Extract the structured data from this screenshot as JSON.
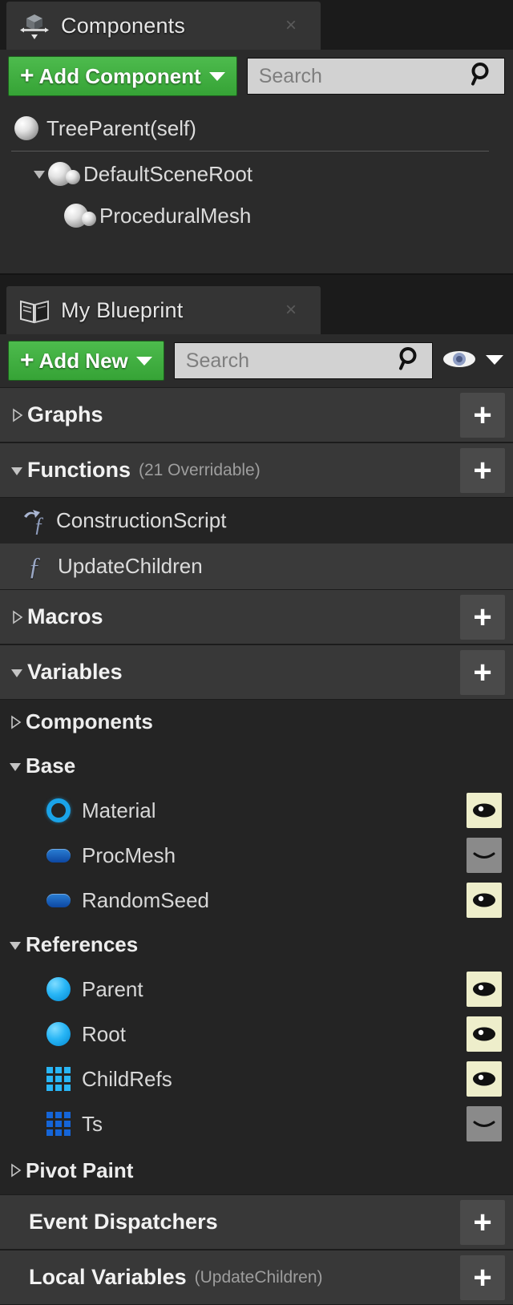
{
  "components_panel": {
    "tab": {
      "label": "Components",
      "icon": "components-gizmo-icon",
      "close": "×"
    },
    "toolbar": {
      "add_label": "Add Component",
      "add_plus": "+",
      "search_placeholder": "Search"
    },
    "tree": [
      {
        "label": "TreeParent(self)",
        "icon": "sphere-icon",
        "depth": 0,
        "expander": "none"
      },
      {
        "label": "DefaultSceneRoot",
        "icon": "scene-component-icon",
        "depth": 1,
        "expander": "expanded"
      },
      {
        "label": "ProceduralMesh",
        "icon": "scene-component-icon",
        "depth": 2,
        "expander": "none"
      }
    ]
  },
  "my_blueprint_panel": {
    "tab": {
      "label": "My Blueprint",
      "icon": "book-icon",
      "close": "×"
    },
    "toolbar": {
      "add_label": "Add New",
      "add_plus": "+",
      "search_placeholder": "Search",
      "eye_icon": "eye-icon",
      "eye_caret": "chevron-down-icon"
    },
    "sections": [
      {
        "title": "Graphs",
        "sub": "",
        "expander": "collapsed",
        "add": "+"
      },
      {
        "title": "Functions",
        "sub": "(21 Overridable)",
        "expander": "expanded",
        "add": "+"
      },
      {
        "title": "Macros",
        "sub": "",
        "expander": "collapsed",
        "add": "+"
      },
      {
        "title": "Variables",
        "sub": "",
        "expander": "expanded",
        "add": "+"
      },
      {
        "title": "Event Dispatchers",
        "sub": "",
        "expander": "none",
        "add": "+"
      },
      {
        "title": "Local Variables",
        "sub": "(UpdateChildren)",
        "expander": "none",
        "add": "+"
      }
    ],
    "functions": [
      {
        "label": "ConstructionScript",
        "glyph": "ƒ",
        "icon": "construction-script-icon",
        "selected": false
      },
      {
        "label": "UpdateChildren",
        "glyph": "ƒ",
        "icon": "function-icon",
        "selected": true
      }
    ],
    "variable_categories": [
      {
        "name": "Components",
        "expander": "collapsed",
        "variables": []
      },
      {
        "name": "Base",
        "expander": "expanded",
        "variables": [
          {
            "name": "Material",
            "pip": "ring",
            "pip_kind": "object-ref-icon",
            "visible": true
          },
          {
            "name": "ProcMesh",
            "pip": "pill",
            "pip_kind": "struct-icon",
            "visible": false
          },
          {
            "name": "RandomSeed",
            "pip": "pill",
            "pip_kind": "struct-icon",
            "visible": true
          }
        ]
      },
      {
        "name": "References",
        "expander": "expanded",
        "variables": [
          {
            "name": "Parent",
            "pip": "ball",
            "pip_kind": "object-icon",
            "visible": true
          },
          {
            "name": "Root",
            "pip": "ball",
            "pip_kind": "object-icon",
            "visible": true
          },
          {
            "name": "ChildRefs",
            "pip": "grid",
            "pip_kind": "array-icon",
            "visible": true
          },
          {
            "name": "Ts",
            "pip": "grid-dark",
            "pip_kind": "array-icon",
            "visible": false
          }
        ]
      },
      {
        "name": "Pivot Paint",
        "expander": "collapsed",
        "variables": []
      }
    ]
  },
  "colors": {
    "accent_green": "#3fae3f",
    "panel_bg": "#242424",
    "section_bg": "#383838",
    "toolbar_bg": "#2b2b2b",
    "tab_bg": "#343434",
    "eye_on_bg": "#eeeecb",
    "eye_off_bg": "#8a8a8a",
    "pip_blue": "#29b6f6",
    "text": "#dcdcdc"
  }
}
